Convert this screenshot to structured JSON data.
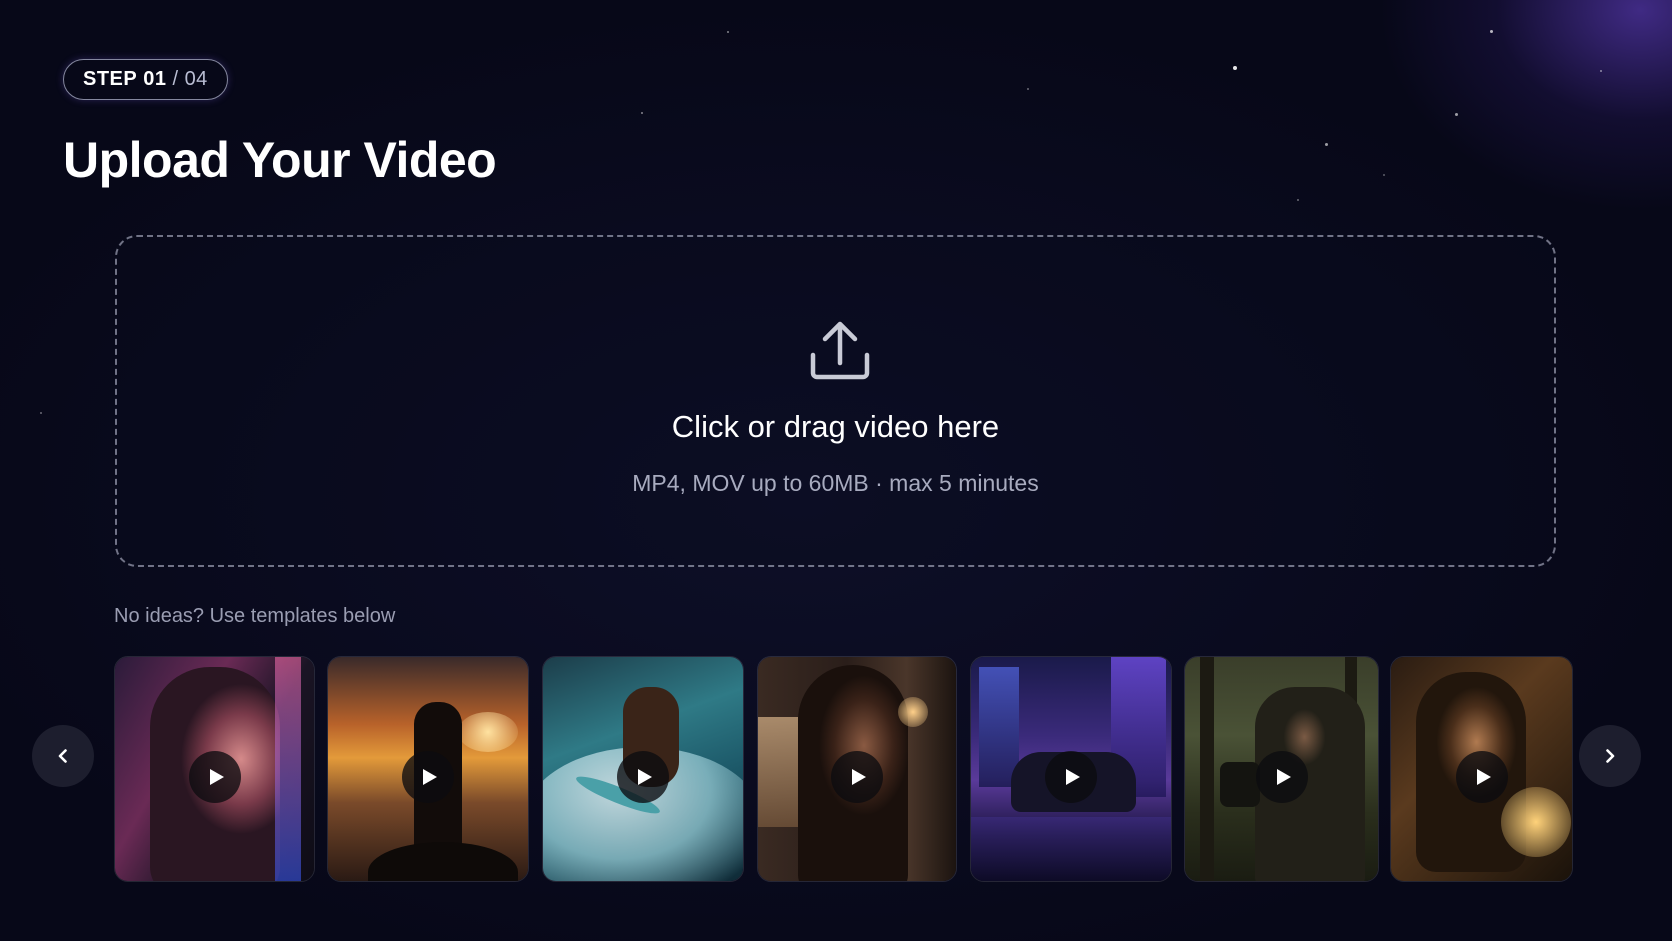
{
  "step": {
    "word": "STEP",
    "current": "01",
    "separator": "/",
    "total": "04"
  },
  "page_title": "Upload Your Video",
  "dropzone": {
    "title": "Click or drag video here",
    "subtitle": "MP4, MOV up to 60MB · max 5 minutes",
    "icon": "upload-icon"
  },
  "templates": {
    "hint": "No ideas? Use templates below",
    "prev_icon": "chevron-left-icon",
    "next_icon": "chevron-right-icon",
    "items": [
      {
        "scene": "portrait-woman-neon"
      },
      {
        "scene": "hiker-silhouette-sunset"
      },
      {
        "scene": "surfer-wave"
      },
      {
        "scene": "woman-profile-dim-room"
      },
      {
        "scene": "car-city-night"
      },
      {
        "scene": "filmmaker-forest"
      },
      {
        "scene": "woman-candlelight"
      }
    ]
  },
  "colors": {
    "background": "#070818",
    "accent_glow": "#6e46dc",
    "text_primary": "#ffffff",
    "text_muted": "#a8abbf"
  }
}
